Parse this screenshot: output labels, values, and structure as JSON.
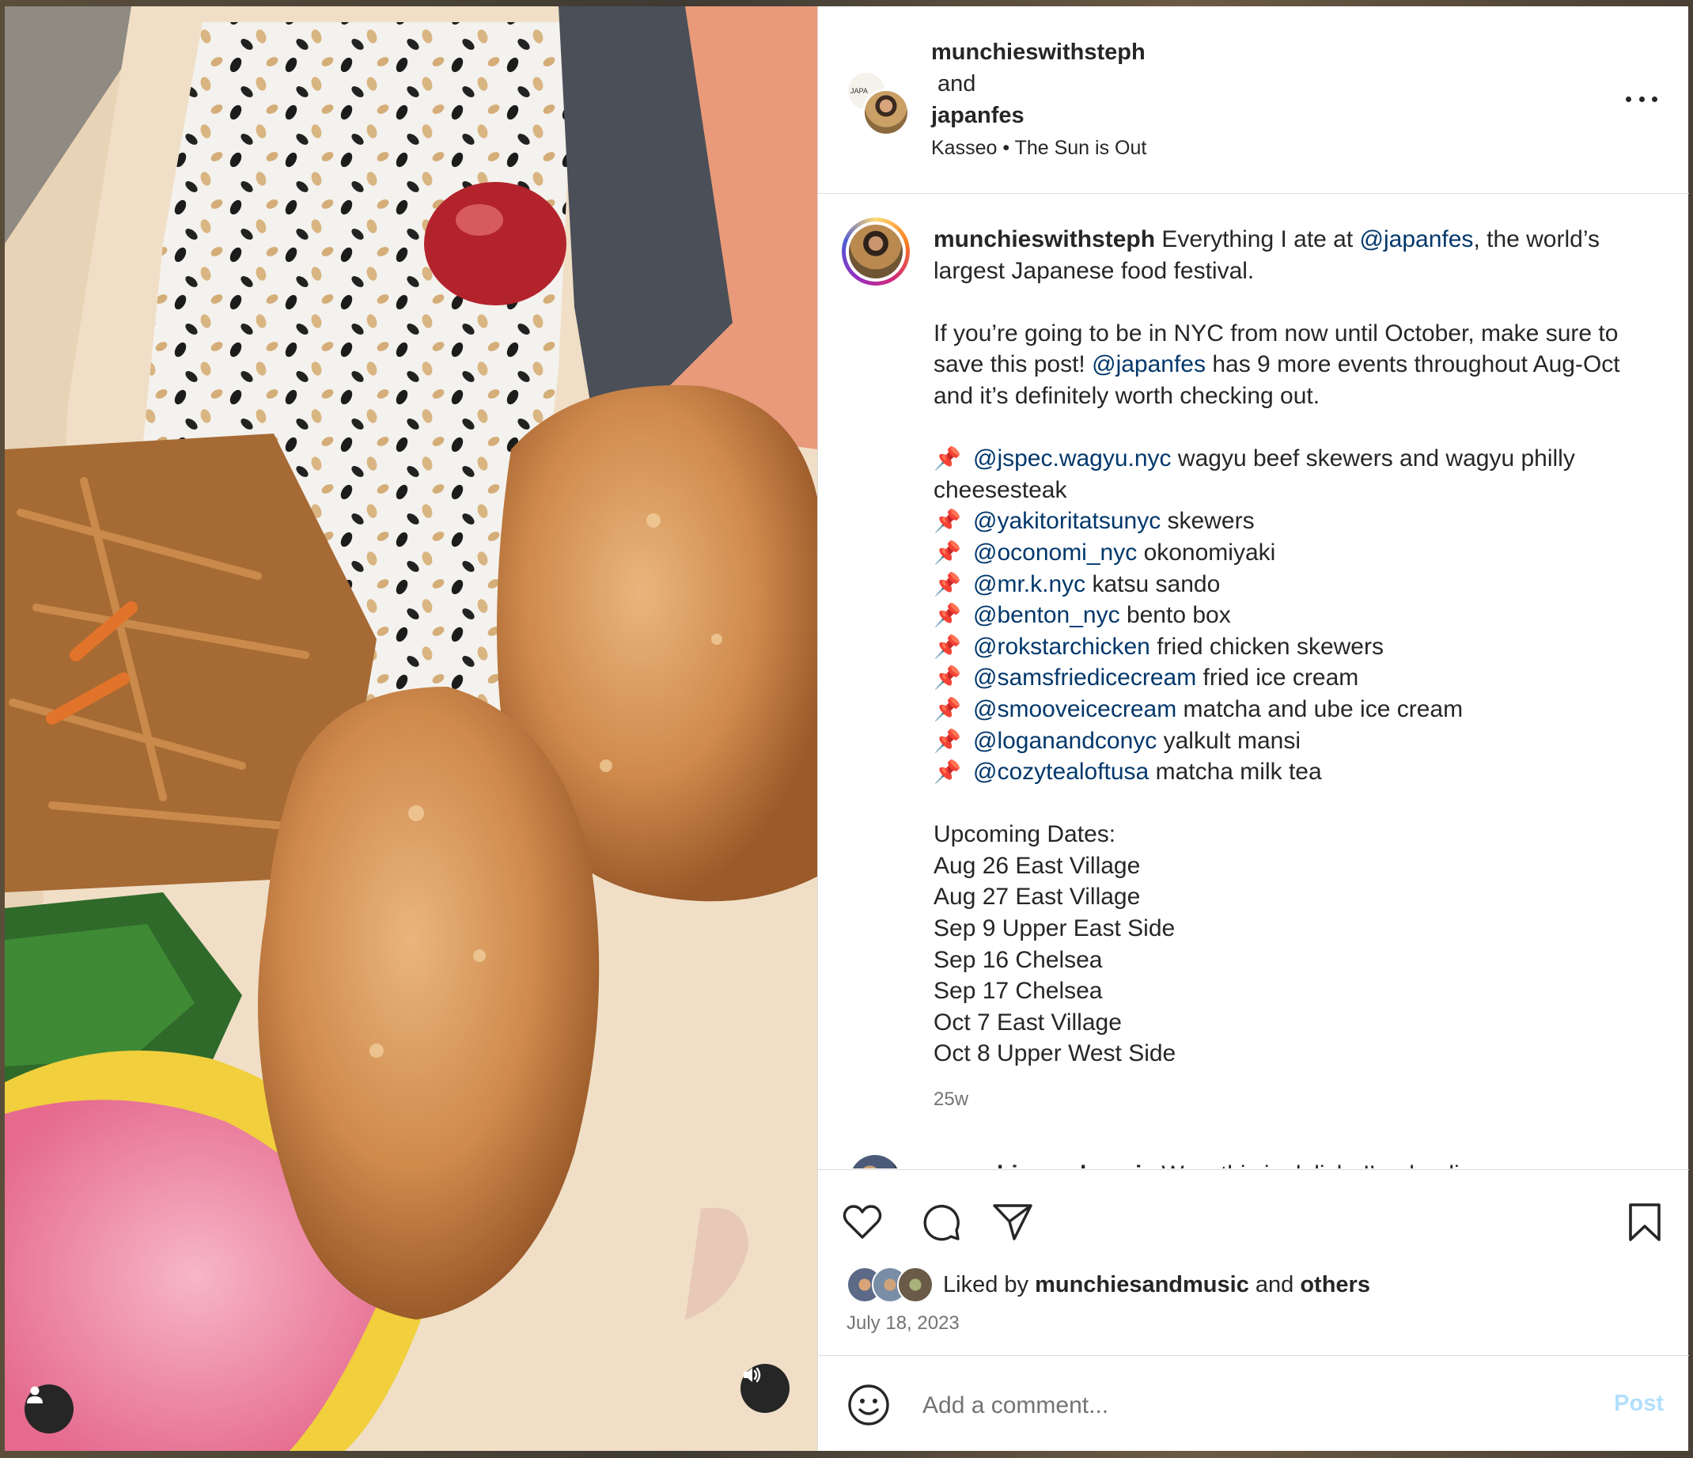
{
  "header": {
    "user1": "munchieswithsteph",
    "and_label": "and",
    "user2": "japanfes",
    "audio": "Kasseo • The Sun is Out",
    "avatar_small_text": "JAPA"
  },
  "caption": {
    "username": "munchieswithsteph",
    "intro_before": "Everything I ate at",
    "intro_mention": "@japanfes",
    "intro_after": ", the world’s largest Japanese food festival.",
    "para2_before": "If you’re going to be in NYC from now until October, make sure to save this post!",
    "para2_mention": "@japanfes",
    "para2_after": "has 9 more events throughout Aug-Oct and it’s definitely worth checking out.",
    "pin_icon": "📌",
    "list": [
      {
        "mention": "@jspec.wagyu.nyc",
        "text": "wagyu beef skewers and wagyu philly cheesesteak"
      },
      {
        "mention": "@yakitoritatsunyc",
        "text": "skewers"
      },
      {
        "mention": "@oconomi_nyc",
        "text": "okonomiyaki"
      },
      {
        "mention": "@mr.k.nyc",
        "text": "katsu sando"
      },
      {
        "mention": "@benton_nyc",
        "text": "bento box"
      },
      {
        "mention": "@rokstarchicken",
        "text": "fried chicken skewers"
      },
      {
        "mention": "@samsfriedicecream",
        "text": "fried ice cream"
      },
      {
        "mention": "@smooveicecream",
        "text": "matcha and ube ice cream"
      },
      {
        "mention": "@loganandconyc",
        "text": "yalkult mansi"
      },
      {
        "mention": "@cozytealoftusa",
        "text": "matcha milk tea"
      }
    ],
    "dates_title": "Upcoming Dates:",
    "dates": [
      "Aug 26 East Village",
      "Aug 27 East Village",
      "Sep 9 Upper East Side",
      "Sep 16 Chelsea",
      "Sep 17 Chelsea",
      "Oct 7 East Village",
      "Oct 8 Upper West Side"
    ],
    "time_ago": "25w"
  },
  "comment": {
    "username": "munchiesandmusic",
    "text": "Wow this is delish, I’m drooling"
  },
  "actions": {
    "like_icon": "heart-icon",
    "comment_icon": "comment-icon",
    "share_icon": "paper-plane-icon",
    "save_icon": "bookmark-icon",
    "liked_by_prefix": "Liked by",
    "liked_by_user": "munchiesandmusic",
    "liked_by_and": "and",
    "liked_by_others": "others",
    "date": "July 18, 2023"
  },
  "add_comment": {
    "placeholder": "Add a comment...",
    "post_label": "Post"
  }
}
